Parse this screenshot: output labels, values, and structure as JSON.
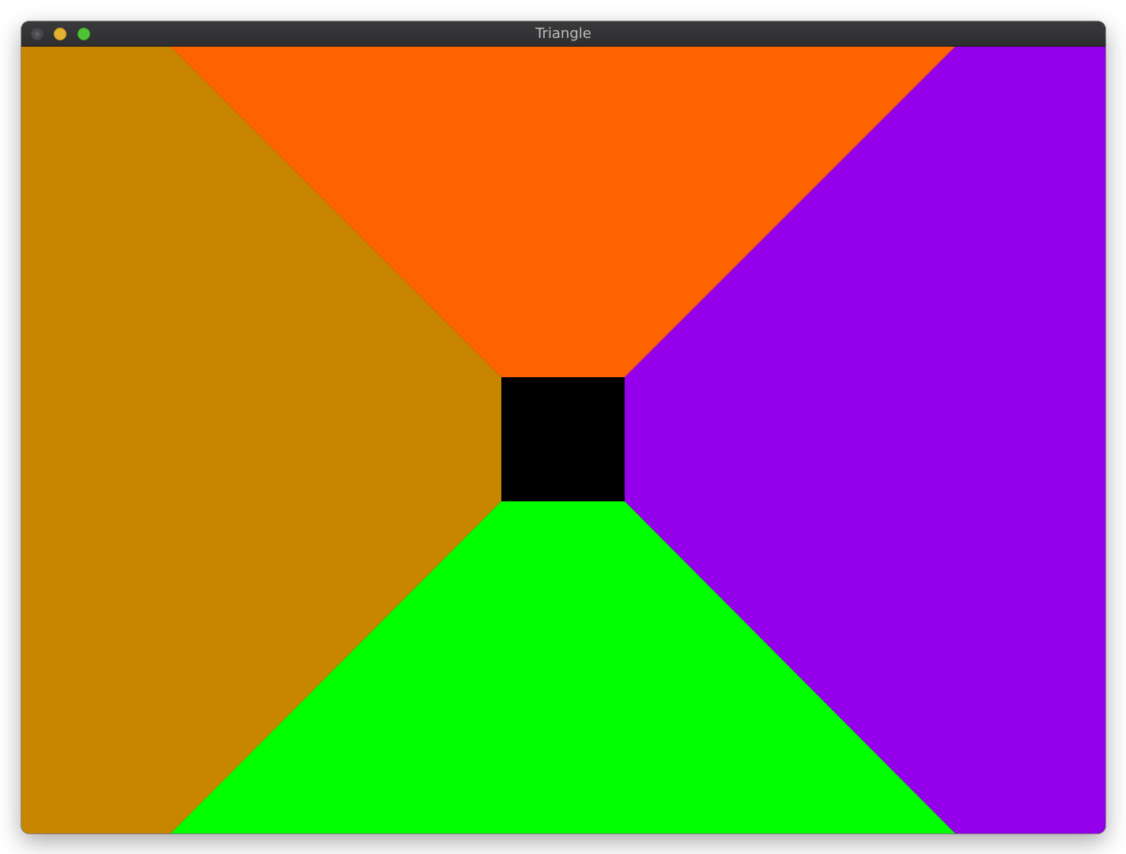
{
  "window": {
    "title": "Triangle"
  },
  "titlebar": {
    "buttons": [
      {
        "name": "close",
        "color": "#4b4b4d"
      },
      {
        "name": "minimize",
        "color": "#e2b130"
      },
      {
        "name": "zoom",
        "color": "#4ec338"
      }
    ]
  },
  "render": {
    "regions": [
      {
        "name": "left-region",
        "color": "#c78500"
      },
      {
        "name": "top-region",
        "color": "#ff6200"
      },
      {
        "name": "right-region",
        "color": "#9300e9"
      },
      {
        "name": "bottom-region",
        "color": "#00ff00"
      },
      {
        "name": "center-square",
        "color": "#000000"
      }
    ]
  }
}
